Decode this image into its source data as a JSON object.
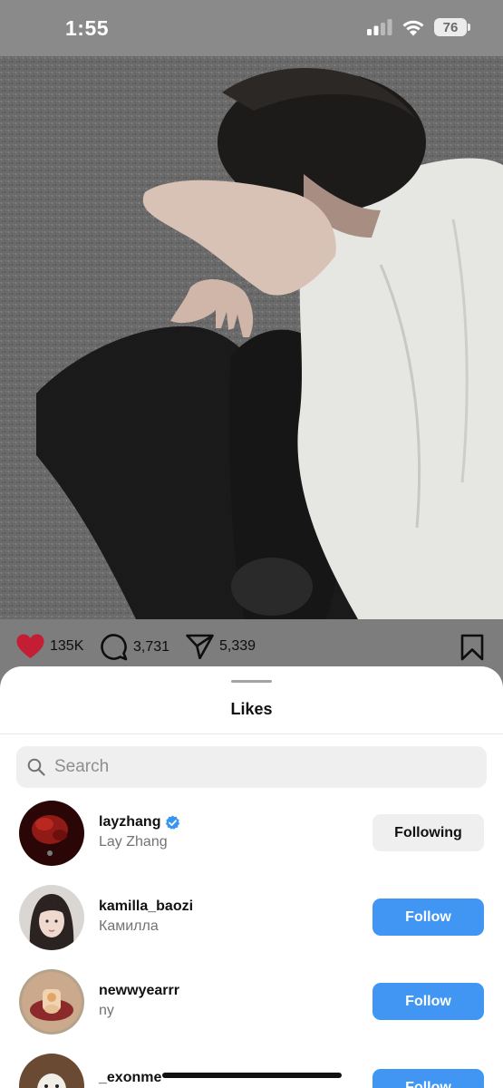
{
  "status_bar": {
    "time": "1:55",
    "battery": "76",
    "icons": [
      "cellular-signal-icon",
      "wifi-icon",
      "battery-icon"
    ]
  },
  "post": {
    "image_alt": "",
    "actions": {
      "likes": "135K",
      "comments": "3,731",
      "shares": "5,339"
    },
    "colors": {
      "like": "#d8203a"
    }
  },
  "likes_sheet": {
    "title": "Likes",
    "search": {
      "placeholder": "Search",
      "value": ""
    },
    "users": [
      {
        "username": "layzhang",
        "name": "Lay Zhang",
        "verified": true,
        "button": "Following"
      },
      {
        "username": "kamilla_baozi",
        "name": "Камилла",
        "verified": false,
        "button": "Follow"
      },
      {
        "username": "newwyearrr",
        "name": "ny",
        "verified": false,
        "button": "Follow"
      },
      {
        "username": "_exonme",
        "name": "",
        "verified": false,
        "button": "Follow"
      }
    ],
    "colors": {
      "follow": "#4096f2",
      "verified": "#3797f0"
    }
  }
}
